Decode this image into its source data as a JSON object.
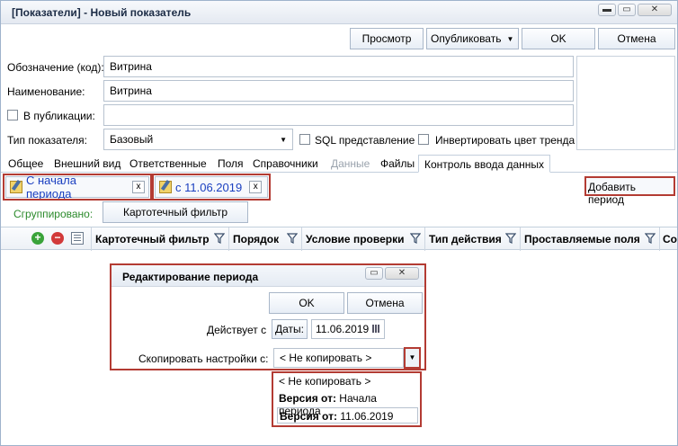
{
  "window": {
    "title": "[Показатели] - Новый показатель",
    "minimize_glyph": "▬",
    "maximize_glyph": "▭",
    "close_glyph": "✕"
  },
  "toolbar": {
    "preview_label": "Просмотр",
    "publish_label": "Опубликовать",
    "publish_arrow": "▼",
    "ok_label": "OK",
    "cancel_label": "Отмена"
  },
  "form": {
    "code_label": "Обозначение (код):",
    "code_value": "Витрина",
    "name_label": "Наименование:",
    "name_value": "Витрина",
    "publications_label": "В публикации:",
    "publications_value": "",
    "type_label": "Тип показателя:",
    "type_value": "Базовый",
    "type_arrow": "▼",
    "sql_label": "SQL представление",
    "invert_label": "Инвертировать цвет тренда"
  },
  "tabs": [
    {
      "label": "Общее"
    },
    {
      "label": "Внешний вид"
    },
    {
      "label": "Ответственные"
    },
    {
      "label": "Поля"
    },
    {
      "label": "Справочники"
    },
    {
      "label": "Данные"
    },
    {
      "label": "Файлы"
    },
    {
      "label": "Контроль ввода данных"
    }
  ],
  "periods": {
    "first_label": "С начала периода",
    "second_label": "с 11.06.2019",
    "close_glyph": "x",
    "add_label": "Добавить период"
  },
  "grouping": {
    "label": "Сгруппировано:",
    "chip_label": "Картотечный фильтр"
  },
  "grid": {
    "columns": [
      {
        "label": "Картотечный фильтр"
      },
      {
        "label": "Порядок"
      },
      {
        "label": "Условие проверки"
      },
      {
        "label": "Тип действия"
      },
      {
        "label": "Проставляемые поля"
      },
      {
        "label": "Со"
      }
    ]
  },
  "dialog": {
    "title": "Редактирование периода",
    "ok_label": "OK",
    "cancel_label": "Отмена",
    "valid_from_label": "Действует с",
    "dates_label": "Даты:",
    "date_value": "11.06.2019",
    "copy_label": "Скопировать настройки с:",
    "copy_value": "< Не копировать >",
    "arrow": "▼"
  },
  "dropdown": {
    "items": [
      {
        "bold": "",
        "text": "< Не копировать >"
      },
      {
        "bold": "Версия от:",
        "text": " Начала периода"
      },
      {
        "bold": "Версия от:",
        "text": " 11.06.2019"
      }
    ]
  }
}
